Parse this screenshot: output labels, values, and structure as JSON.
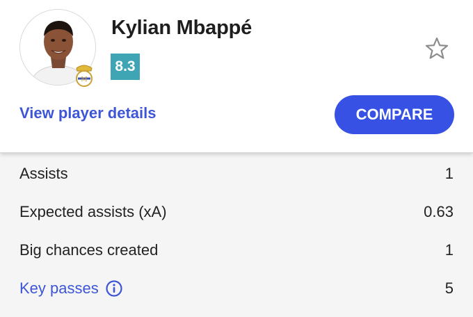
{
  "player": {
    "name": "Kylian Mbappé",
    "rating": "8.3",
    "details_link": "View player details",
    "compare_label": "COMPARE"
  },
  "stats": [
    {
      "label": "Assists",
      "value": "1"
    },
    {
      "label": "Expected assists (xA)",
      "value": "0.63"
    },
    {
      "label": "Big chances created",
      "value": "1"
    },
    {
      "label": "Key passes",
      "value": "5"
    }
  ],
  "icons": {
    "favorite": "star-outline-icon",
    "info": "info-icon",
    "club": "club-crest-icon"
  },
  "colors": {
    "accent": "#3651e3",
    "link": "#3d55d6",
    "rating_bg": "#3fa5b5"
  }
}
